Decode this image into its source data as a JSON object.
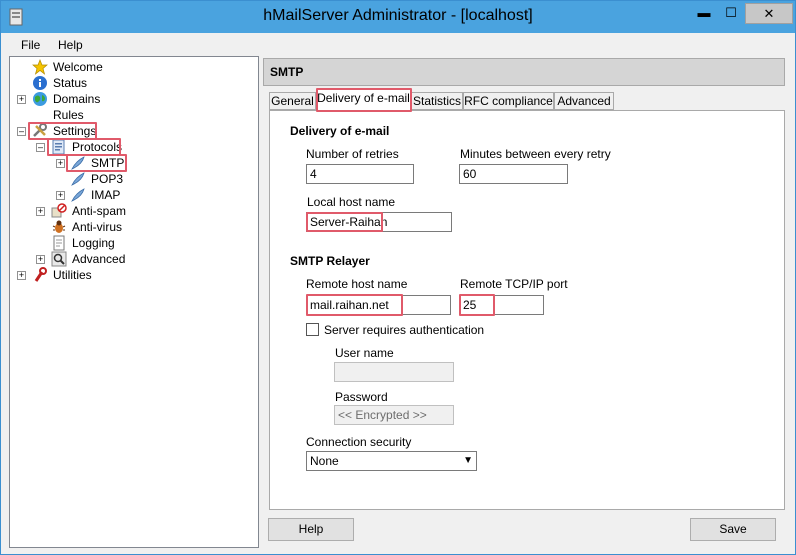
{
  "window": {
    "title": "hMailServer Administrator - [localhost]"
  },
  "menu": {
    "file": "File",
    "help": "Help"
  },
  "tree": {
    "welcome": "Welcome",
    "status": "Status",
    "domains": "Domains",
    "rules": "Rules",
    "settings": "Settings",
    "protocols": "Protocols",
    "smtp": "SMTP",
    "pop3": "POP3",
    "imap": "IMAP",
    "antispam": "Anti-spam",
    "antivirus": "Anti-virus",
    "logging": "Logging",
    "advanced": "Advanced",
    "utilities": "Utilities"
  },
  "panel": {
    "title": "SMTP"
  },
  "tabs": {
    "general": "General",
    "delivery": "Delivery of e-mail",
    "statistics": "Statistics",
    "rfc": "RFC compliance",
    "advanced": "Advanced"
  },
  "delivery": {
    "section_title": "Delivery of e-mail",
    "retries_label": "Number of retries",
    "retries_value": "4",
    "minutes_label": "Minutes between every retry",
    "minutes_value": "60",
    "local_host_label": "Local host name",
    "local_host_value": "Server-Raihan"
  },
  "relayer": {
    "section_title": "SMTP Relayer",
    "remote_host_label": "Remote host name",
    "remote_host_value": "mail.raihan.net",
    "port_label": "Remote TCP/IP port",
    "port_value": "25",
    "auth_label": "Server requires authentication",
    "auth_checked": false,
    "username_label": "User name",
    "username_value": "",
    "password_label": "Password",
    "password_value": "<< Encrypted >>",
    "security_label": "Connection security",
    "security_value": "None"
  },
  "buttons": {
    "help": "Help",
    "save": "Save"
  },
  "colors": {
    "titlebar": "#4aa3df",
    "highlight": "#e05a6a"
  },
  "icons": {
    "welcome": "star-icon",
    "status": "info-icon",
    "domains": "globe-icon",
    "settings": "tools-icon",
    "protocols": "document-icon",
    "protocol_item": "feather-icon",
    "antispam": "no-entry-icon",
    "antivirus": "bug-icon",
    "logging": "page-icon",
    "advanced": "magnifier-icon",
    "utilities": "wrench-icon"
  }
}
